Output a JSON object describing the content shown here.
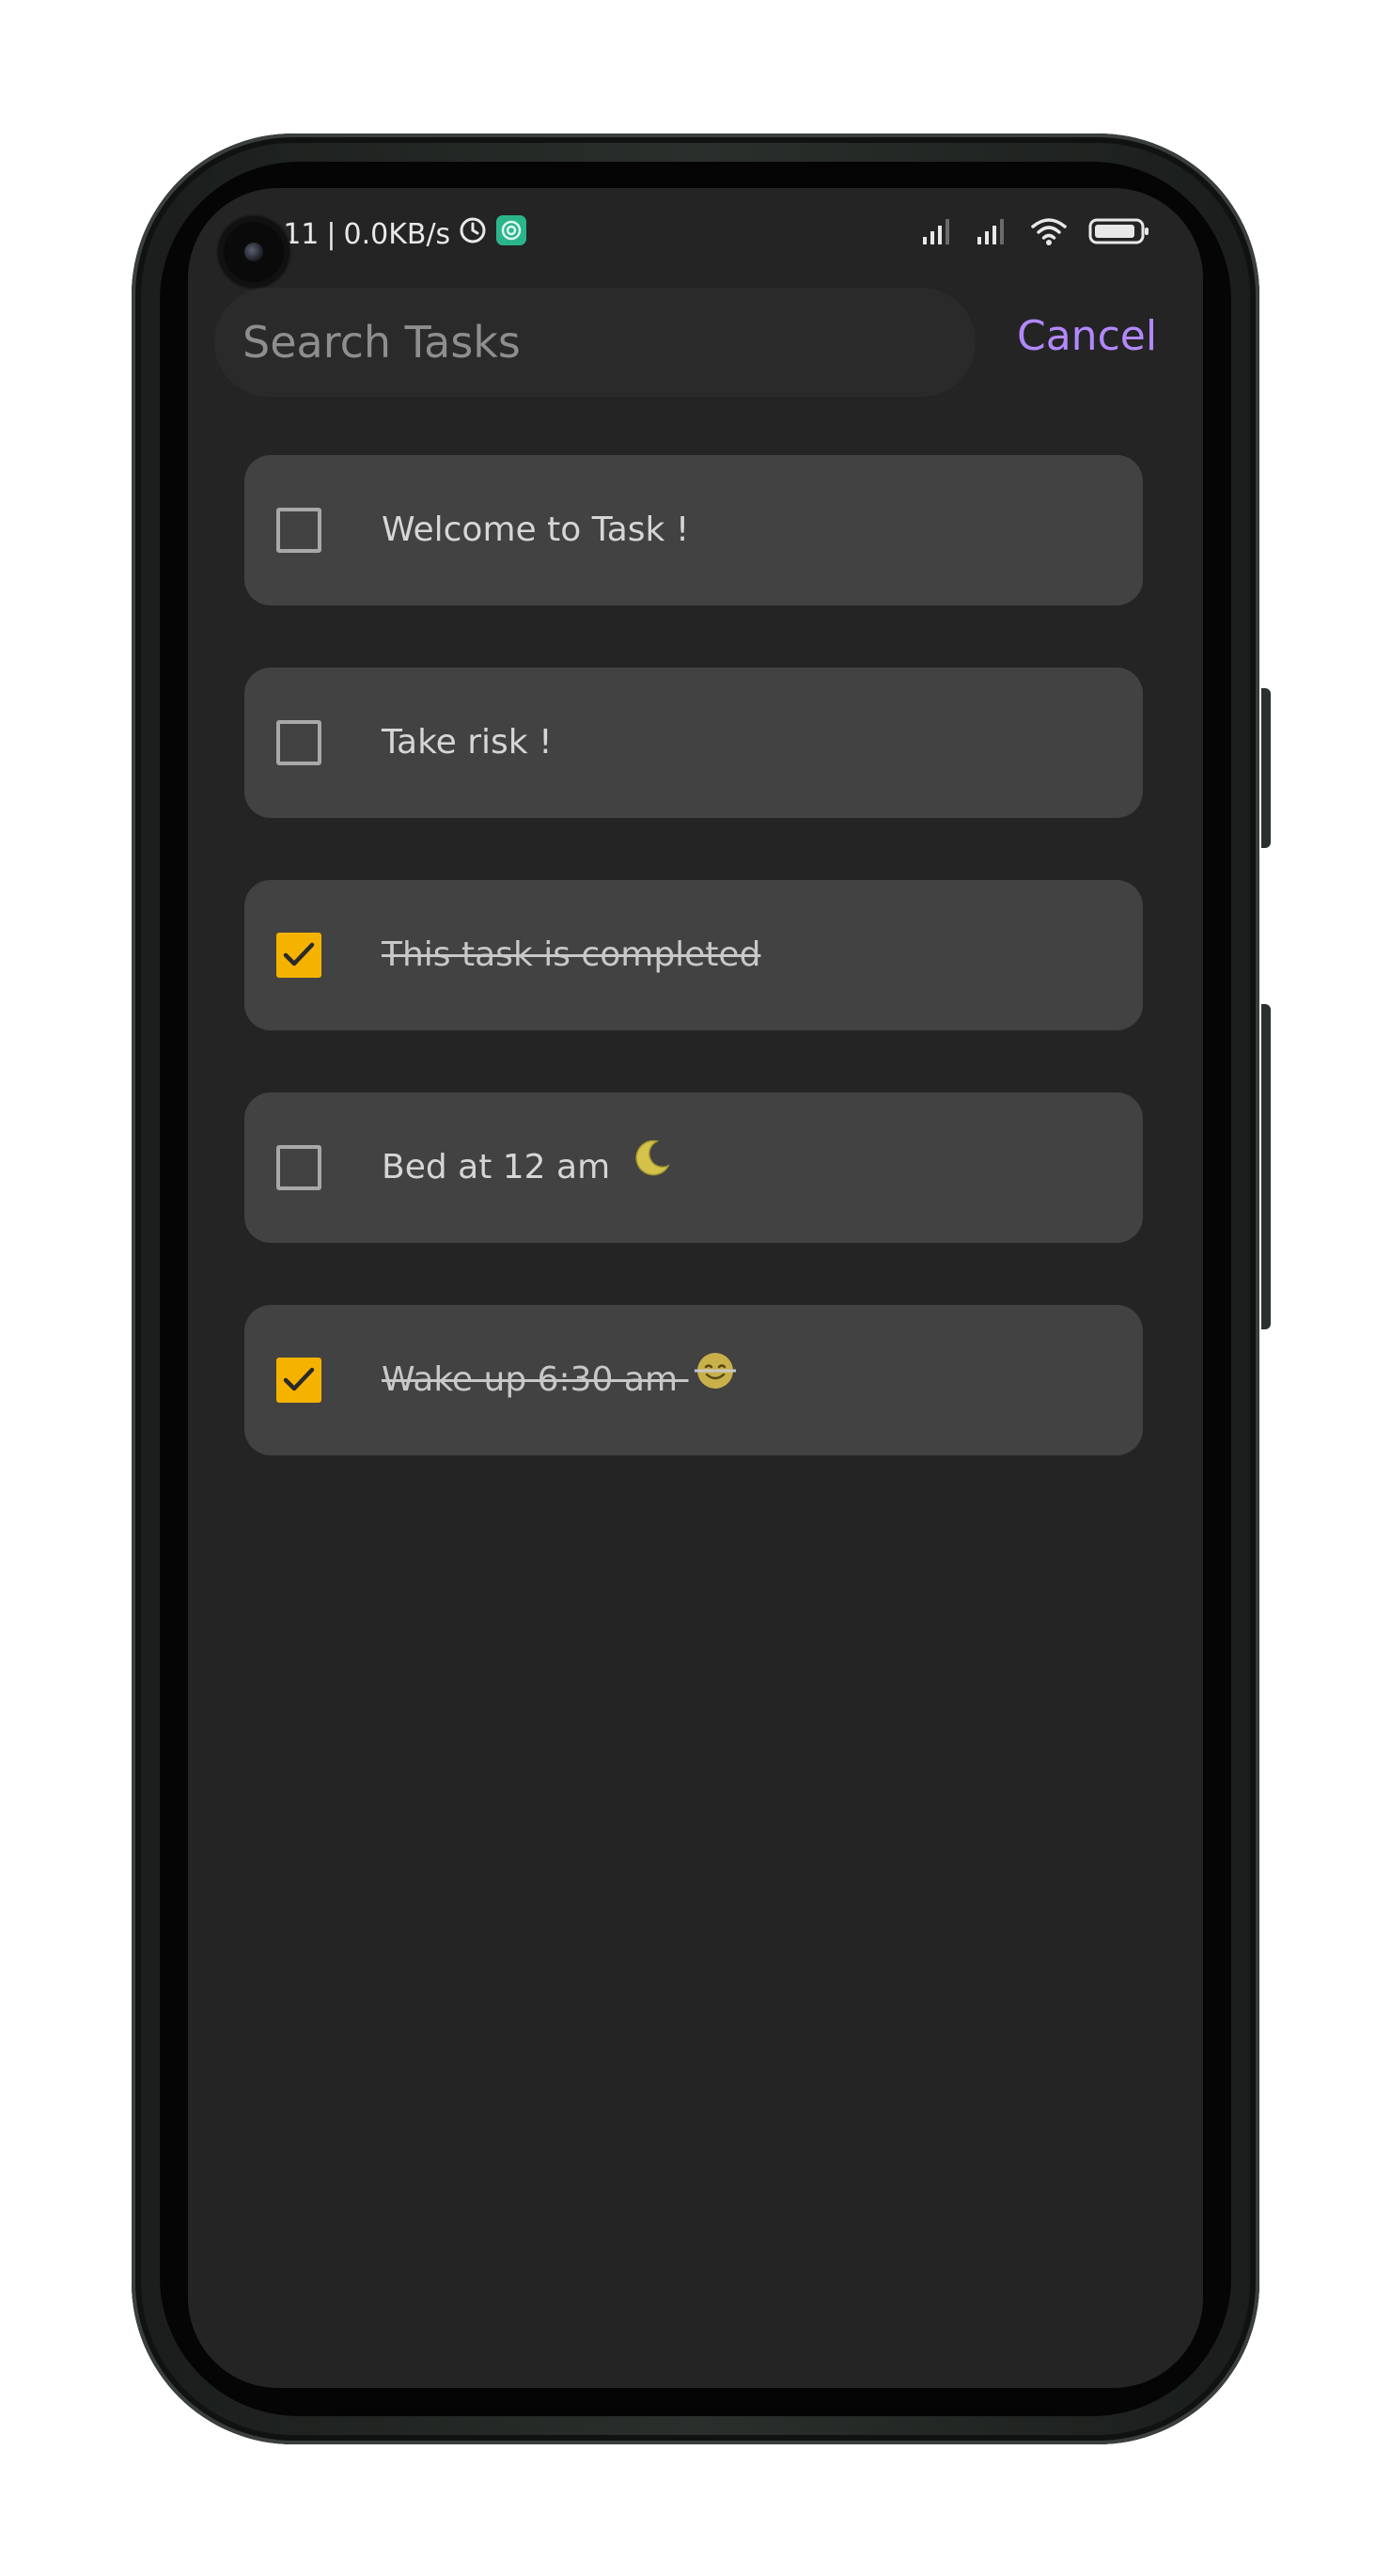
{
  "status_bar": {
    "time": "5:11",
    "separator": "|",
    "network_speed": "0.0KB/s",
    "icons": [
      "alarm-icon",
      "app-notification-icon",
      "signal-icon",
      "signal-icon",
      "wifi-icon",
      "battery-icon"
    ]
  },
  "search": {
    "placeholder": "Search Tasks",
    "value": "",
    "cancel_label": "Cancel"
  },
  "tasks": [
    {
      "label": "Welcome to Task !",
      "completed": false,
      "emoji": ""
    },
    {
      "label": "Take risk !",
      "completed": false,
      "emoji": ""
    },
    {
      "label": "This task is completed",
      "completed": true,
      "emoji": ""
    },
    {
      "label": "Bed at 12 am",
      "completed": false,
      "emoji": "crescent-moon-icon"
    },
    {
      "label": "Wake up 6:30 am",
      "completed": true,
      "emoji": "smiling-face-icon"
    }
  ],
  "colors": {
    "background": "#242424",
    "card": "#424242",
    "accent_checkbox": "#f5b300",
    "cancel": "#b388ff",
    "app_notification_icon": "#2bb58a"
  }
}
